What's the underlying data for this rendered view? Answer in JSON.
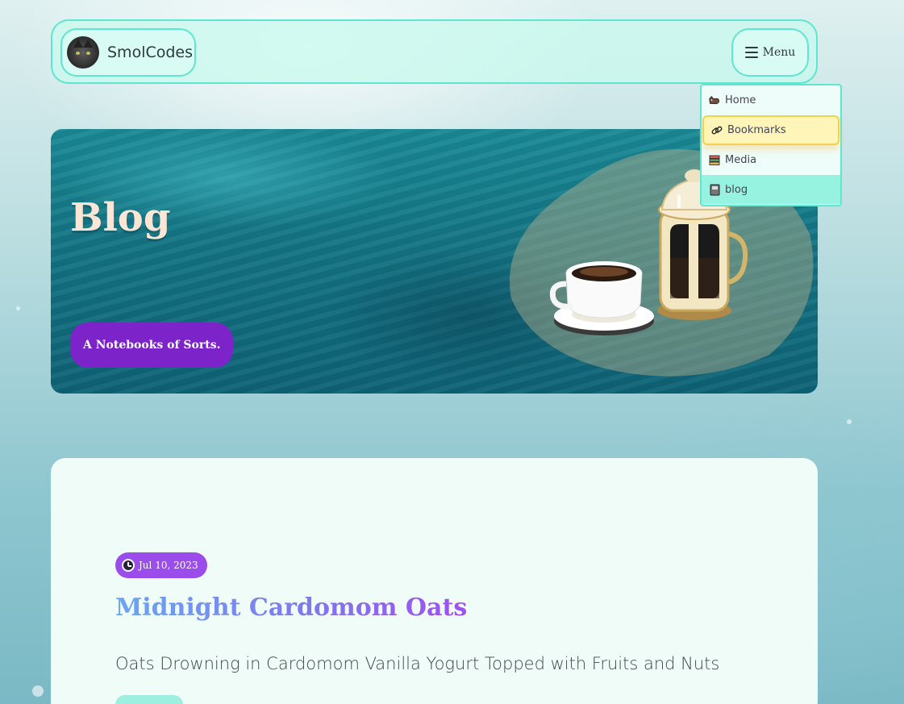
{
  "brand": {
    "name": "SmolCodes",
    "avatar_icon": "cat-avatar"
  },
  "nav": {
    "menu_label": "Menu",
    "menu_icon": "hamburger-icon"
  },
  "dropdown": {
    "items": [
      {
        "label": "Home",
        "icon": "cat-icon",
        "state": "normal"
      },
      {
        "label": "Bookmarks",
        "icon": "link-icon",
        "state": "hover"
      },
      {
        "label": "Media",
        "icon": "books-icon",
        "state": "normal"
      },
      {
        "label": "blog",
        "icon": "notebook-icon",
        "state": "active"
      }
    ]
  },
  "hero": {
    "title": "Blog",
    "subtitle": "A Notebooks of Sorts.",
    "illustration": "coffee-cup-and-french-press"
  },
  "post": {
    "date": "Jul 10, 2023",
    "title": "Midnight Cardomom Oats",
    "description": "Oats Drowning in Cardomom Vanilla Yogurt Topped with Fruits and Nuts"
  },
  "colors": {
    "accent_teal": "#5ee6cf",
    "purple": "#7c23c9",
    "badge_purple": "#9b4dec",
    "hover_yellow": "#fff5b8",
    "active_mint": "#95f3e0"
  }
}
